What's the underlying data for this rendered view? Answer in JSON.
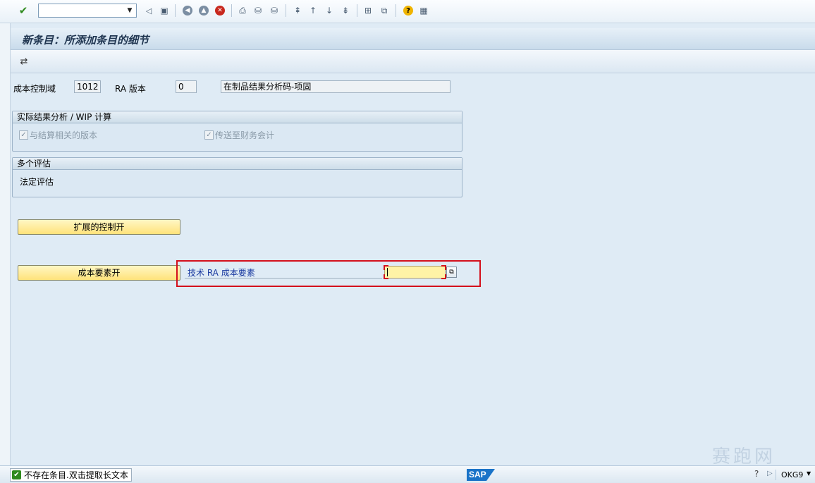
{
  "toolbar": {
    "okcode_value": "",
    "icons": [
      "enter-icon",
      "back-triangle-icon",
      "save-icon",
      "back-icon",
      "exit-icon",
      "cancel-icon",
      "print-icon",
      "find-icon",
      "find-next-icon",
      "first-page-icon",
      "previous-page-icon",
      "next-page-icon",
      "last-page-icon",
      "create-session-icon",
      "shortcut-icon",
      "help-icon",
      "layout-icon"
    ]
  },
  "title": "新条目：所添加条目的细节",
  "app_toolbar": {
    "icons": [
      "other-entry-icon"
    ]
  },
  "header": {
    "cost_controlling_label": "成本控制域",
    "cost_controlling_value": "1012",
    "ra_version_label": "RA 版本",
    "ra_version_value": "0",
    "description_value": "在制品结果分析码-项固"
  },
  "group_actual": {
    "title": "实际结果分析 / WIP 计算",
    "check_settlement_label": "与结算相关的版本",
    "check_settlement_checked": true,
    "check_transfer_label": "传送至财务会计",
    "check_transfer_checked": true
  },
  "group_valuation": {
    "title": "多个评估",
    "legal_valuation_label": "法定评估"
  },
  "buttons": {
    "extended_control_label": "扩展的控制开",
    "cost_elements_label": "成本要素开"
  },
  "tech_ra": {
    "label": "技术 RA 成本要素",
    "value": ""
  },
  "status": {
    "message": "不存在条目.双击提取长文本",
    "logo": "SAP",
    "transaction": "OKG9"
  },
  "watermark": "赛跑网"
}
